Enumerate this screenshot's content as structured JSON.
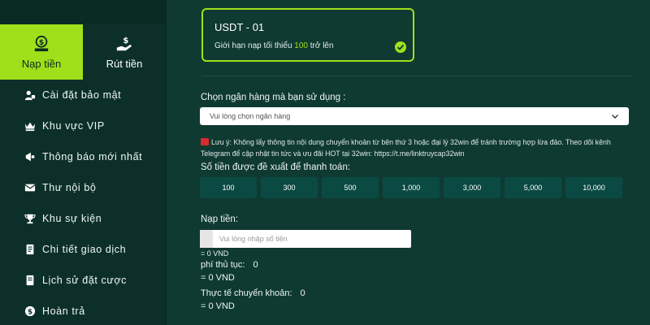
{
  "sidebar": {
    "tabs": [
      {
        "label": "Nạp tiền",
        "icon": "deposit-icon",
        "active": true
      },
      {
        "label": "Rút tiền",
        "icon": "withdraw-icon",
        "active": false
      }
    ],
    "items": [
      {
        "label": "Cài đặt bảo mật",
        "icon": "security-icon"
      },
      {
        "label": "Khu vực VIP",
        "icon": "vip-crown-icon"
      },
      {
        "label": "Thông báo mới nhất",
        "icon": "notification-icon"
      },
      {
        "label": "Thư nội bộ",
        "icon": "mail-icon"
      },
      {
        "label": "Khu sự kiện",
        "icon": "trophy-icon"
      },
      {
        "label": "Chi tiết giao dịch",
        "icon": "transaction-icon"
      },
      {
        "label": "Lịch sử đặt cược",
        "icon": "history-icon"
      },
      {
        "label": "Hoàn trả",
        "icon": "refund-icon"
      }
    ]
  },
  "card": {
    "title": "USDT - 01",
    "desc_before": "Giới hạn nạp tối thiểu",
    "desc_highlight": "100",
    "desc_after": "trở lên"
  },
  "bank": {
    "label": "Chọn ngân hàng mà bạn sử dụng :",
    "placeholder": "Vui lòng chọn ngân hàng"
  },
  "notice": {
    "text": "Lưu ý: Không lấy thông tin nội dung chuyển khoản từ bên thứ 3 hoặc đại lý 32win để tránh trường hợp lừa đảo. Theo dõi kênh Telegram để cập nhật tin tức và ưu đãi HOT tại 32win: https://t.me/linktruycap32win"
  },
  "amounts": {
    "label": "Số tiền được đề xuất để thanh toán:",
    "options": [
      "100",
      "300",
      "500",
      "1,000",
      "3,000",
      "5,000",
      "10,000"
    ]
  },
  "deposit": {
    "label": "Nạp tiền:",
    "placeholder": "Vui lòng nhập số tiền",
    "converted": "= 0 VND",
    "fee_label": "phí thủ tục:",
    "fee_value": "0",
    "fee_vnd": "= 0 VND",
    "actual_label": "Thực tế chuyển khoản:",
    "actual_value": "0",
    "actual_vnd": "= 0 VND"
  },
  "colors": {
    "accent": "#9fe01a",
    "background": "#0f3a32",
    "sidebar": "#0c3029",
    "amount_button": "#0a4a42"
  }
}
